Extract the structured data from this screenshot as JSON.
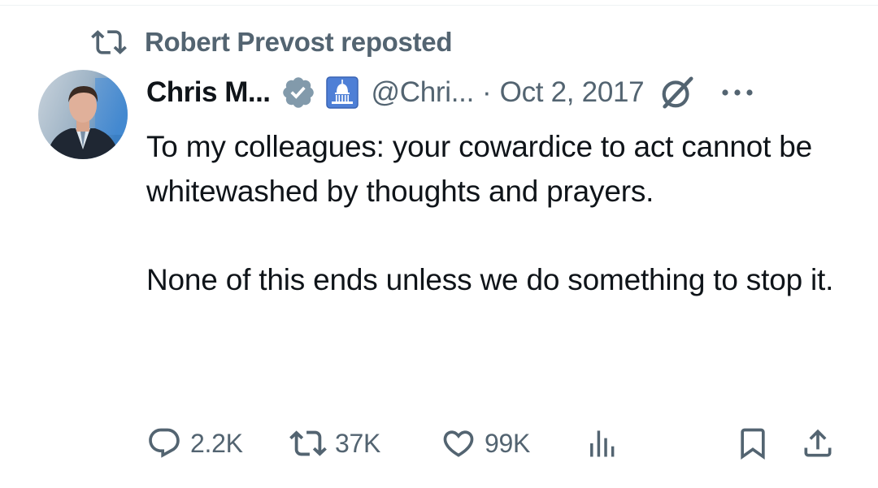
{
  "repost": {
    "icon": "repost-icon",
    "text": "Robert Prevost reposted"
  },
  "author": {
    "display_name": "Chris M...",
    "verified_icon": "verified-badge-icon",
    "affiliation_icon": "capitol-icon",
    "handle": "@Chri...",
    "separator": "·",
    "date": "Oct 2, 2017"
  },
  "tweet": {
    "paragraphs": [
      "To my colleagues: your cowardice to act cannot be whitewashed by thoughts and prayers.",
      "None of this ends unless we do something to stop it."
    ]
  },
  "actions": {
    "replies": "2.2K",
    "reposts": "37K",
    "likes": "99K",
    "views": "",
    "reply_icon": "reply-icon",
    "repost_icon": "repost-icon",
    "like_icon": "heart-icon",
    "views_icon": "views-chart-icon",
    "bookmark_icon": "bookmark-icon",
    "share_icon": "share-icon"
  },
  "colors": {
    "text": "#0f1419",
    "secondary": "#536471",
    "verified": "#829aab"
  }
}
